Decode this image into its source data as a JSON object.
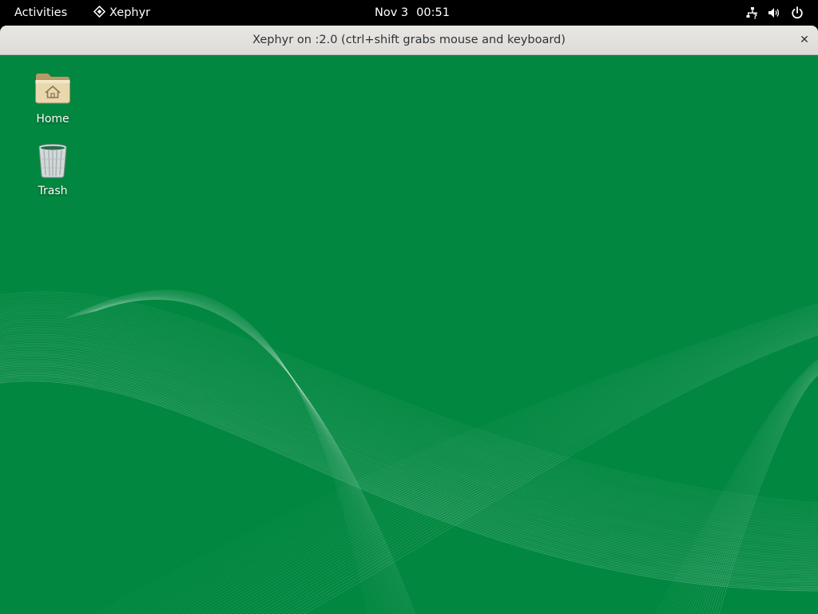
{
  "topbar": {
    "activities_label": "Activities",
    "app_name": "Xephyr",
    "clock_date": "Nov 3",
    "clock_time": "00:51",
    "icons": [
      "network-question-icon",
      "volume-icon",
      "power-icon"
    ]
  },
  "window": {
    "title": "Xephyr on :2.0 (ctrl+shift grabs mouse and keyboard)",
    "close_glyph": "✕"
  },
  "desktop": {
    "background_color": "#01873f",
    "icons": [
      {
        "label": "Home",
        "icon": "home-folder-icon"
      },
      {
        "label": "Trash",
        "icon": "trash-icon"
      }
    ]
  }
}
